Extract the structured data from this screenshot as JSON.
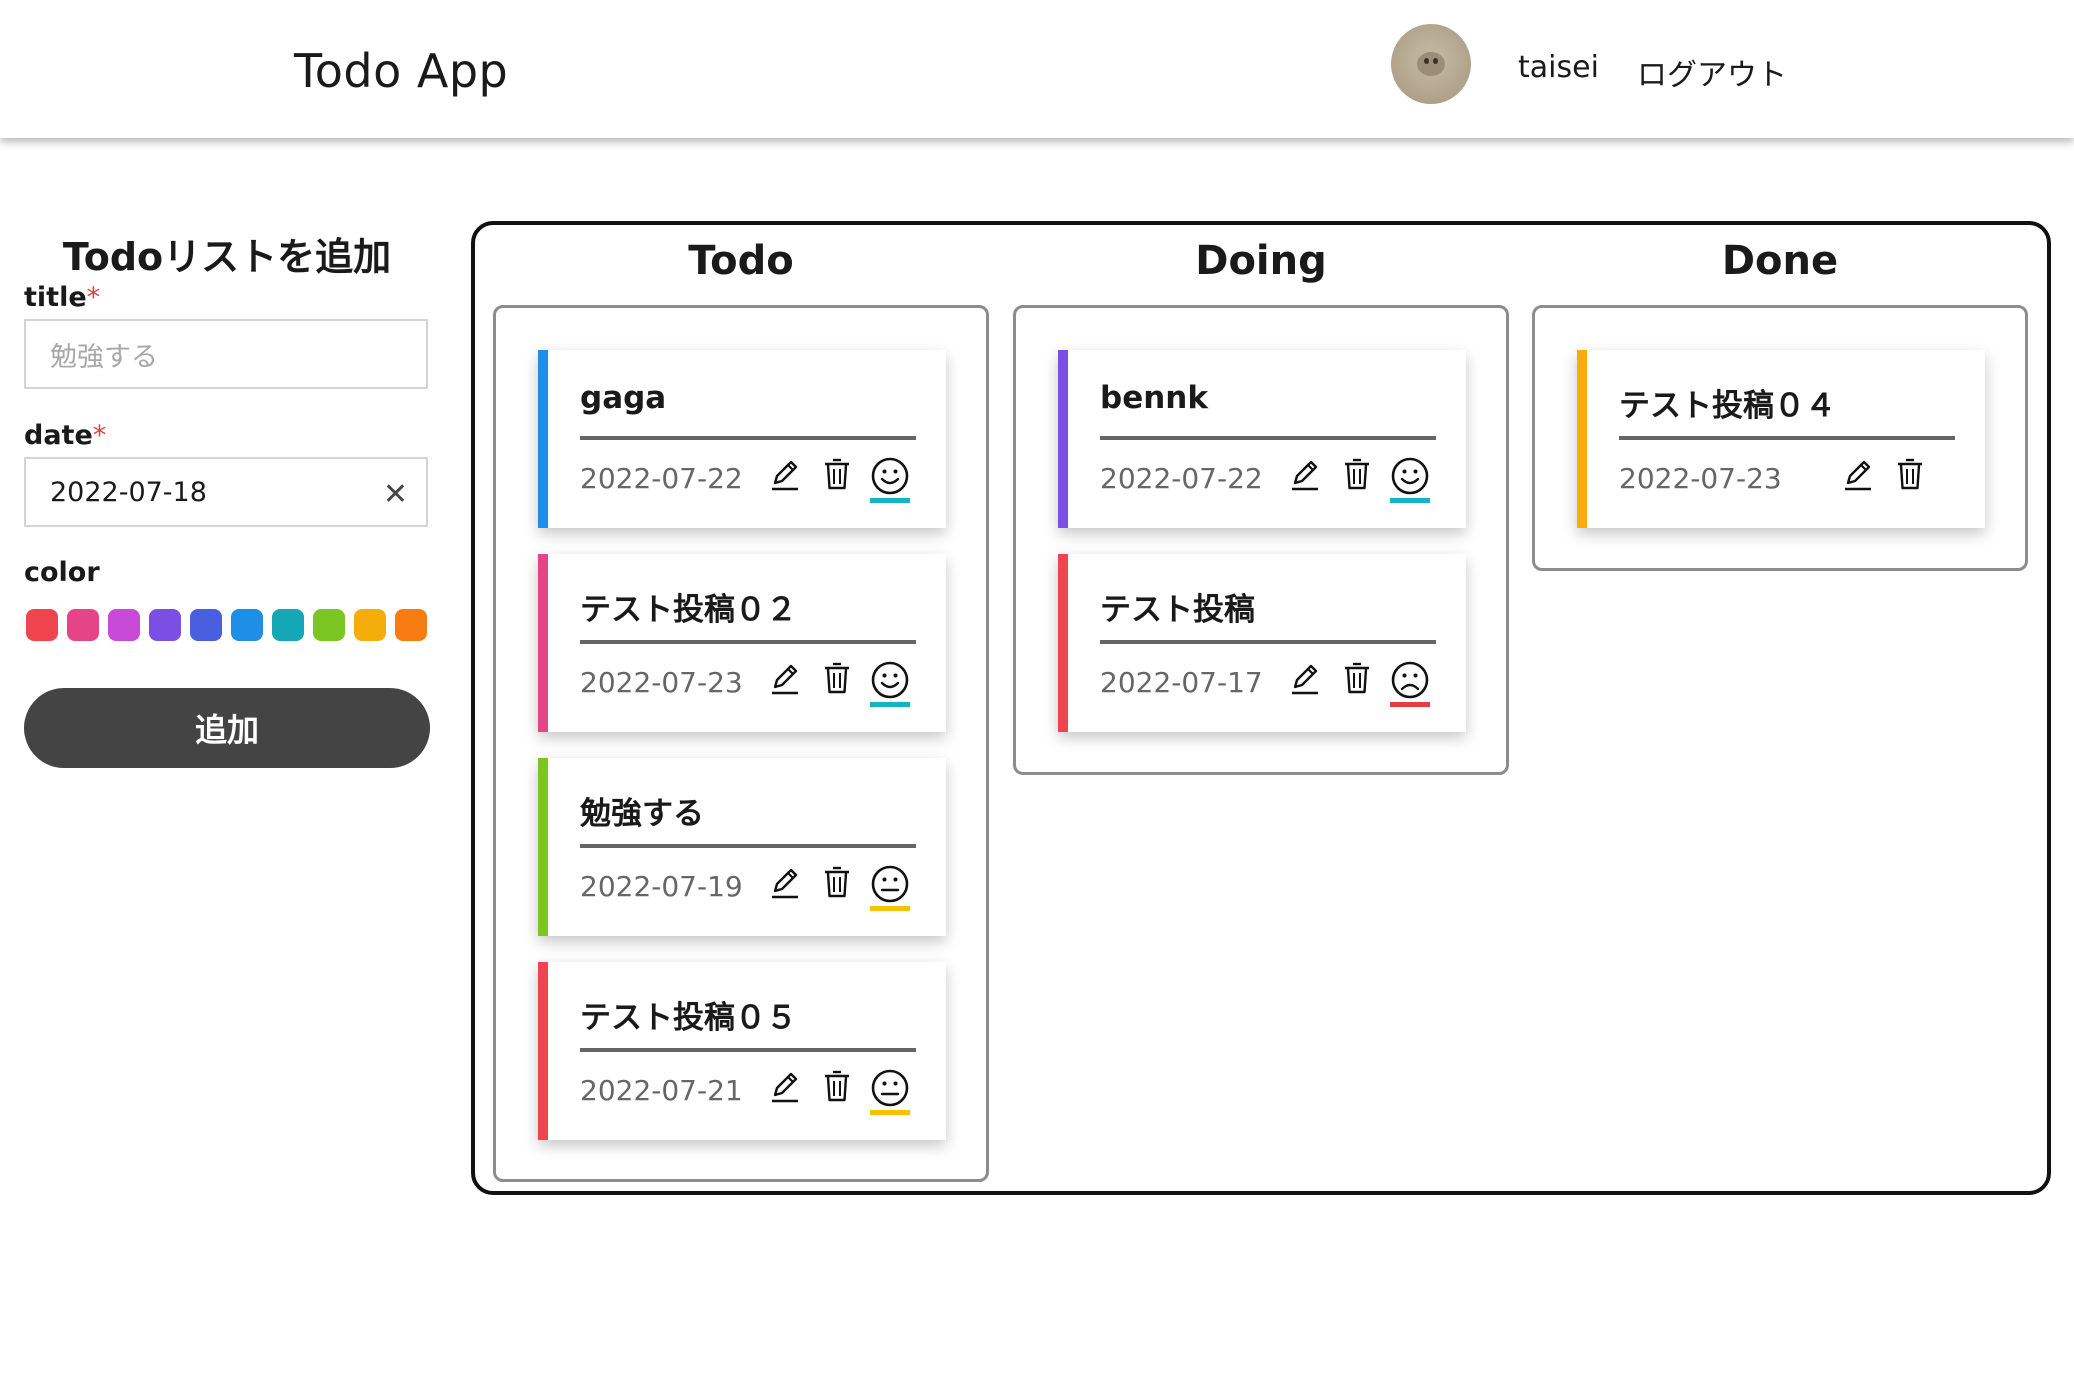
{
  "header": {
    "title": "Todo App",
    "user_name": "taisei",
    "logout_label": "ログアウト"
  },
  "form": {
    "heading": "Todoリストを追加",
    "title_label": "title",
    "title_required": "*",
    "title_placeholder": "勉強する",
    "date_label": "date",
    "date_required": "*",
    "date_value": "2022-07-18",
    "color_label": "color",
    "colors": [
      "#f0444e",
      "#e54587",
      "#c84bd8",
      "#7b4fe4",
      "#4a5fe0",
      "#1f8ee6",
      "#14a8b6",
      "#7cc624",
      "#f5ad0a",
      "#f77c12"
    ],
    "submit_label": "追加"
  },
  "columns": [
    {
      "title": "Todo",
      "cards": [
        {
          "title": "gaga",
          "date": "2022-07-22",
          "color": "#1f8ee6",
          "mood": "smile",
          "mood_color": "#14b5bf"
        },
        {
          "title": "テスト投稿０２",
          "date": "2022-07-23",
          "color": "#e54587",
          "mood": "smile",
          "mood_color": "#14b5bf"
        },
        {
          "title": "勉強する",
          "date": "2022-07-19",
          "color": "#7cc624",
          "mood": "neutral",
          "mood_color": "#f2c500"
        },
        {
          "title": "テスト投稿０５",
          "date": "2022-07-21",
          "color": "#f0444e",
          "mood": "neutral",
          "mood_color": "#f2c500"
        }
      ]
    },
    {
      "title": "Doing",
      "cards": [
        {
          "title": "bennk",
          "date": "2022-07-22",
          "color": "#7b4fe4",
          "mood": "smile",
          "mood_color": "#14b5bf"
        },
        {
          "title": "テスト投稿",
          "date": "2022-07-17",
          "color": "#f0444e",
          "mood": "sad",
          "mood_color": "#e53e3e"
        }
      ]
    },
    {
      "title": "Done",
      "cards": [
        {
          "title": "テスト投稿０４",
          "date": "2022-07-23",
          "color": "#f5ad0a",
          "mood": "none"
        }
      ]
    }
  ],
  "icons": {
    "edit": "pencil-icon",
    "delete": "trash-icon",
    "mood": "face-icon",
    "clear": "close-icon"
  }
}
